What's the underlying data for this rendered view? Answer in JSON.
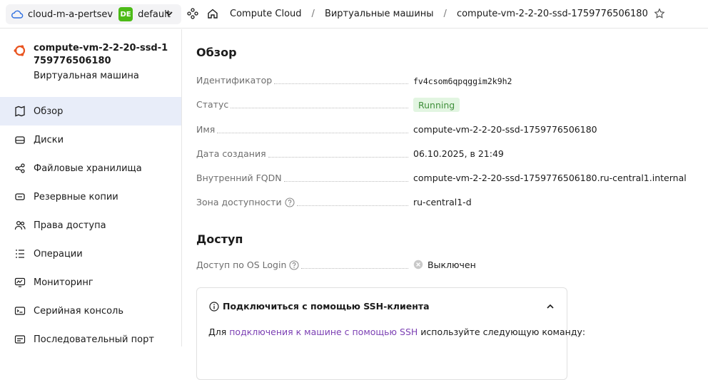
{
  "topbar": {
    "cloud_name": "cloud-m-a-pertsev",
    "folder_badge": "DE",
    "folder_name": "default",
    "breadcrumbs": [
      "Compute Cloud",
      "Виртуальные машины",
      "compute-vm-2-2-20-ssd-1759776506180"
    ],
    "separator": "/"
  },
  "sidebar": {
    "resource_title": "compute-vm-2-2-20-ssd-1759776506180",
    "resource_subtitle": "Виртуальная машина",
    "items": [
      {
        "label": "Обзор",
        "icon": "overview-icon",
        "active": true
      },
      {
        "label": "Диски",
        "icon": "disk-icon"
      },
      {
        "label": "Файловые хранилища",
        "icon": "file-storage-icon"
      },
      {
        "label": "Резервные копии",
        "icon": "backup-icon"
      },
      {
        "label": "Права доступа",
        "icon": "access-rights-icon"
      },
      {
        "label": "Операции",
        "icon": "operations-icon"
      },
      {
        "label": "Мониторинг",
        "icon": "monitoring-icon"
      },
      {
        "label": "Серийная консоль",
        "icon": "serial-console-icon"
      },
      {
        "label": "Последовательный порт",
        "icon": "serial-port-icon"
      }
    ]
  },
  "overview": {
    "title": "Обзор",
    "rows": [
      {
        "label": "Идентификатор",
        "value": "fv4csom6qpqggim2k9h2"
      },
      {
        "label": "Статус",
        "value": "Running"
      },
      {
        "label": "Имя",
        "value": "compute-vm-2-2-20-ssd-1759776506180"
      },
      {
        "label": "Дата создания",
        "value": "06.10.2025, в 21:49"
      },
      {
        "label": "Внутренний FQDN",
        "value": "compute-vm-2-2-20-ssd-1759776506180.ru-central1.internal"
      },
      {
        "label": "Зона доступности",
        "value": "ru-central1-d"
      }
    ]
  },
  "access": {
    "title": "Доступ",
    "os_login_label": "Доступ по OS Login",
    "os_login_value": "Выключен",
    "ssh_card": {
      "title": "Подключиться с помощью SSH-клиента",
      "text_before": "Для ",
      "link": "подключения к машине с помощью SSH",
      "text_after": " используйте следующую команду:"
    }
  },
  "colors": {
    "accent_active_bg": "#e8edf9",
    "status_bg": "#e2f5e1",
    "status_text": "#3f8f3a",
    "folder_badge": "#4cbb17",
    "link": "#7b3fb3",
    "ubuntu_orange": "#e95420"
  }
}
